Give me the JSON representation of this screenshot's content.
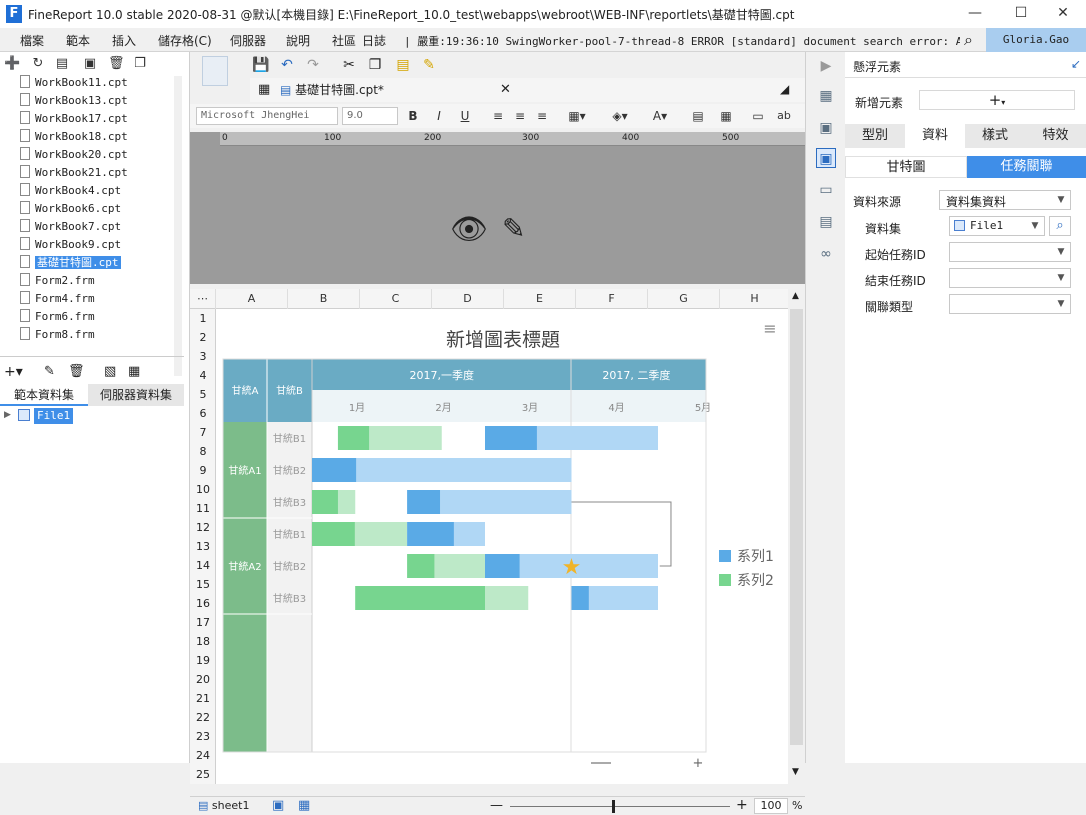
{
  "window": {
    "title": "FineReport 10.0 stable 2020-08-31 @默认[本機目錄]    E:\\FineReport_10.0_test\\webapps\\webroot\\WEB-INF\\reportlets\\基礎甘特圖.cpt",
    "min": "—",
    "max": "☐",
    "close": "✕"
  },
  "menu": [
    "檔案",
    "範本",
    "插入",
    "儲存格(C)",
    "伺服器",
    "說明",
    "社區",
    "日誌"
  ],
  "log": "| 嚴重:19:36:10 SwingWorker-pool-7-thread-8 ERROR [standard] document search error: A JSONOb...",
  "user": "Gloria.Gao",
  "files": [
    {
      "name": "WorkBook11.cpt"
    },
    {
      "name": "WorkBook13.cpt"
    },
    {
      "name": "WorkBook17.cpt"
    },
    {
      "name": "WorkBook18.cpt"
    },
    {
      "name": "WorkBook20.cpt"
    },
    {
      "name": "WorkBook21.cpt"
    },
    {
      "name": "WorkBook4.cpt"
    },
    {
      "name": "WorkBook6.cpt"
    },
    {
      "name": "WorkBook7.cpt"
    },
    {
      "name": "WorkBook9.cpt"
    },
    {
      "name": "基礎甘特圖.cpt",
      "selected": true
    },
    {
      "name": "Form2.frm"
    },
    {
      "name": "Form4.frm"
    },
    {
      "name": "Form6.frm"
    },
    {
      "name": "Form8.frm"
    }
  ],
  "dataset_tabs": [
    "範本資料集",
    "伺服器資料集"
  ],
  "dataset_item": "File1",
  "editor_tab": "基礎甘特圖.cpt*",
  "font_name": "Microsoft JhengHei",
  "font_size": "9.0",
  "format_buttons": {
    "bold": "B",
    "italic": "I",
    "underline": "U",
    "wrap": "ab"
  },
  "ruler": [
    "0",
    "100",
    "200",
    "300",
    "400",
    "500"
  ],
  "columns": [
    "A",
    "B",
    "C",
    "D",
    "E",
    "F",
    "G",
    "H"
  ],
  "rows": [
    "1",
    "2",
    "3",
    "4",
    "5",
    "6",
    "7",
    "8",
    "9",
    "10",
    "11",
    "12",
    "13",
    "14",
    "15",
    "16",
    "17",
    "18",
    "19",
    "20",
    "21",
    "22",
    "23",
    "24",
    "25"
  ],
  "sheet_tab": "sheet1",
  "zoom": "100",
  "zoom_unit": "%",
  "chart_data": {
    "type": "gantt",
    "title": "新增圖表標題",
    "header_left": [
      "甘統A",
      "甘統B"
    ],
    "period_headers": [
      "2017,一季度",
      "2017, 二季度"
    ],
    "months": [
      "1月",
      "2月",
      "3月",
      "4月",
      "5月"
    ],
    "group_a": [
      "甘統A1",
      "甘統A2"
    ],
    "group_b": [
      "甘統B1",
      "甘統B2",
      "甘統B3",
      "甘統B1",
      "甘統B2",
      "甘統B3"
    ],
    "series": [
      {
        "name": "系列1",
        "color": "#5aaae6"
      },
      {
        "name": "系列2",
        "color": "#77d58f"
      }
    ],
    "tasks": [
      {
        "row": 0,
        "start": 0.3,
        "end": 1.5,
        "progress": 0.3,
        "series": 1
      },
      {
        "row": 0,
        "start": 2.0,
        "end": 4.0,
        "progress": 0.3,
        "series": 0
      },
      {
        "row": 1,
        "start": 0.0,
        "end": 3.0,
        "progress": 0.17,
        "series": 0
      },
      {
        "row": 2,
        "start": 0.0,
        "end": 0.5,
        "progress": 0.6,
        "series": 1
      },
      {
        "row": 2,
        "start": 1.1,
        "end": 3.0,
        "progress": 0.2,
        "series": 0
      },
      {
        "row": 3,
        "start": 0.0,
        "end": 1.1,
        "progress": 0.45,
        "series": 1
      },
      {
        "row": 3,
        "start": 1.1,
        "end": 2.0,
        "progress": 0.6,
        "series": 0
      },
      {
        "row": 4,
        "start": 1.1,
        "end": 2.0,
        "progress": 0.35,
        "series": 1
      },
      {
        "row": 4,
        "start": 2.0,
        "end": 4.0,
        "progress": 0.2,
        "series": 0
      },
      {
        "row": 5,
        "start": 0.5,
        "end": 2.5,
        "progress": 0.75,
        "series": 1
      },
      {
        "row": 5,
        "start": 3.0,
        "end": 4.0,
        "progress": 0.2,
        "series": 0
      }
    ]
  },
  "right_panel": {
    "header": "懸浮元素",
    "add_label": "新增元素",
    "tabs": [
      "型別",
      "資料",
      "樣式",
      "特效"
    ],
    "subtabs": [
      "甘特圖",
      "任務關聯"
    ],
    "fields": {
      "source_label": "資料來源",
      "source_value": "資料集資料",
      "dataset_label": "資料集",
      "dataset_value": "File1",
      "start_label": "起始任務ID",
      "end_label": "結束任務ID",
      "type_label": "關聯類型"
    }
  }
}
